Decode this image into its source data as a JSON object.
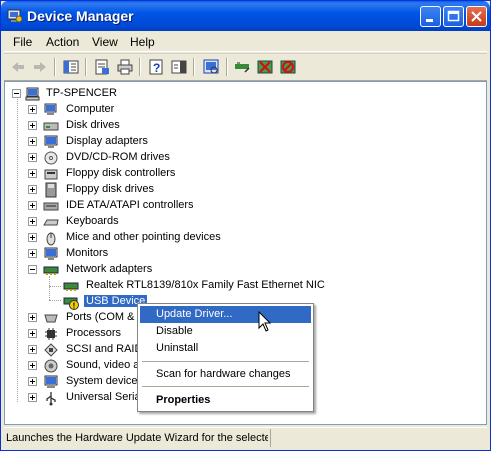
{
  "window": {
    "title": "Device Manager",
    "icon": "computer-manage-icon"
  },
  "title_buttons": {
    "minimize": "minimize-icon",
    "maximize": "maximize-icon",
    "close": "close-icon"
  },
  "menubar": {
    "items": [
      "File",
      "Action",
      "View",
      "Help"
    ]
  },
  "toolbar": {
    "buttons": [
      "back-icon",
      "forward-icon",
      "show-hide-console-tree-icon",
      "properties-icon",
      "print-icon",
      "help-icon",
      "show-hide-action-pane-icon",
      "scan-hardware-icon",
      "update-driver-icon",
      "uninstall-icon",
      "disable-icon"
    ]
  },
  "tree": {
    "root": "TP-SPENCER",
    "items": [
      {
        "label": "Computer",
        "icon": "computer-icon"
      },
      {
        "label": "Disk drives",
        "icon": "disk-drive-icon"
      },
      {
        "label": "Display adapters",
        "icon": "display-adapter-icon"
      },
      {
        "label": "DVD/CD-ROM drives",
        "icon": "cdrom-icon"
      },
      {
        "label": "Floppy disk controllers",
        "icon": "floppy-controller-icon"
      },
      {
        "label": "Floppy disk drives",
        "icon": "floppy-drive-icon"
      },
      {
        "label": "IDE ATA/ATAPI controllers",
        "icon": "ide-controller-icon"
      },
      {
        "label": "Keyboards",
        "icon": "keyboard-icon"
      },
      {
        "label": "Mice and other pointing devices",
        "icon": "mouse-icon"
      },
      {
        "label": "Monitors",
        "icon": "monitor-icon"
      },
      {
        "label": "Network adapters",
        "icon": "network-adapter-icon"
      },
      {
        "label": "Realtek RTL8139/810x Family Fast Ethernet NIC",
        "icon": "network-card-icon"
      },
      {
        "label": "USB Device",
        "icon": "warning-device-icon"
      },
      {
        "label": "Ports (COM & LPT)",
        "icon": "port-icon"
      },
      {
        "label": "Processors",
        "icon": "processor-icon"
      },
      {
        "label": "SCSI and RAID controllers",
        "icon": "scsi-icon"
      },
      {
        "label": "Sound, video and game controllers",
        "icon": "sound-icon"
      },
      {
        "label": "System devices",
        "icon": "system-device-icon"
      },
      {
        "label": "Universal Serial Bus controllers",
        "icon": "usb-icon"
      }
    ]
  },
  "context_menu": {
    "items": [
      "Update Driver...",
      "Disable",
      "Uninstall",
      "Scan for hardware changes",
      "Properties"
    ]
  },
  "statusbar": {
    "text": "Launches the Hardware Update Wizard for the selected device."
  },
  "colors": {
    "titlebar": "#0055e5",
    "selection": "#316ac5",
    "chrome": "#ece9d8"
  }
}
